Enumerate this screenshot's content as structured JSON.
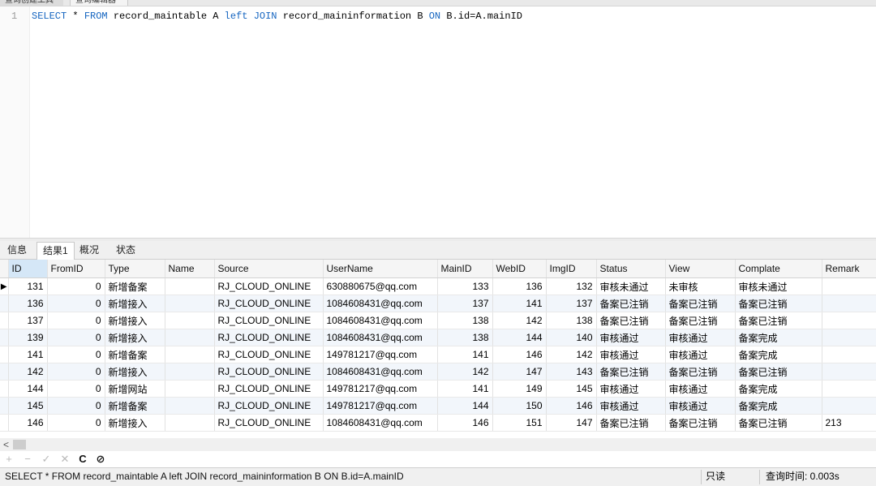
{
  "top_tabs": [
    "查询创建工具",
    "查询编辑器"
  ],
  "editor": {
    "line_number": "1",
    "sql_tokens": [
      {
        "t": "SELECT",
        "kw": true
      },
      {
        "t": " * ",
        "kw": false
      },
      {
        "t": "FROM",
        "kw": true
      },
      {
        "t": " record_maintable A ",
        "kw": false
      },
      {
        "t": "left",
        "kw": true
      },
      {
        "t": " ",
        "kw": false
      },
      {
        "t": "JOIN",
        "kw": true
      },
      {
        "t": " record_maininformation B ",
        "kw": false
      },
      {
        "t": "ON",
        "kw": true
      },
      {
        "t": " B.id=A.mainID",
        "kw": false
      }
    ]
  },
  "result_tabs": [
    {
      "label": "信息",
      "active": false
    },
    {
      "label": "结果1",
      "active": true
    },
    {
      "label": "概况",
      "active": false
    },
    {
      "label": "状态",
      "active": false
    }
  ],
  "grid": {
    "columns": [
      "ID",
      "FromID",
      "Type",
      "Name",
      "Source",
      "UserName",
      "MainID",
      "WebID",
      "ImgID",
      "Status",
      "View",
      "Complate",
      "Remark"
    ],
    "current_row_marker": "▶",
    "rows": [
      [
        "131",
        "0",
        "新增备案",
        "",
        "RJ_CLOUD_ONLINE",
        "630880675@qq.com",
        "133",
        "136",
        "132",
        "审核未通过",
        "未审核",
        "审核未通过",
        ""
      ],
      [
        "136",
        "0",
        "新增接入",
        "",
        "RJ_CLOUD_ONLINE",
        "1084608431@qq.com",
        "137",
        "141",
        "137",
        "备案已注销",
        "备案已注销",
        "备案已注销",
        ""
      ],
      [
        "137",
        "0",
        "新增接入",
        "",
        "RJ_CLOUD_ONLINE",
        "1084608431@qq.com",
        "138",
        "142",
        "138",
        "备案已注销",
        "备案已注销",
        "备案已注销",
        ""
      ],
      [
        "139",
        "0",
        "新增接入",
        "",
        "RJ_CLOUD_ONLINE",
        "1084608431@qq.com",
        "138",
        "144",
        "140",
        "审核通过",
        "审核通过",
        "备案完成",
        ""
      ],
      [
        "141",
        "0",
        "新增备案",
        "",
        "RJ_CLOUD_ONLINE",
        "149781217@qq.com",
        "141",
        "146",
        "142",
        "审核通过",
        "审核通过",
        "备案完成",
        ""
      ],
      [
        "142",
        "0",
        "新增接入",
        "",
        "RJ_CLOUD_ONLINE",
        "1084608431@qq.com",
        "142",
        "147",
        "143",
        "备案已注销",
        "备案已注销",
        "备案已注销",
        ""
      ],
      [
        "144",
        "0",
        "新增网站",
        "",
        "RJ_CLOUD_ONLINE",
        "149781217@qq.com",
        "141",
        "149",
        "145",
        "审核通过",
        "审核通过",
        "备案完成",
        ""
      ],
      [
        "145",
        "0",
        "新增备案",
        "",
        "RJ_CLOUD_ONLINE",
        "149781217@qq.com",
        "144",
        "150",
        "146",
        "审核通过",
        "审核通过",
        "备案完成",
        ""
      ],
      [
        "146",
        "0",
        "新增接入",
        "",
        "RJ_CLOUD_ONLINE",
        "1084608431@qq.com",
        "146",
        "151",
        "147",
        "备案已注销",
        "备案已注销",
        "备案已注销",
        "213"
      ]
    ]
  },
  "scrollbar": {
    "left_arrow": "<"
  },
  "toolbar": {
    "add": "+",
    "delete": "−",
    "apply": "✓",
    "cancel": "✕",
    "refresh": "C",
    "stop": "⊘",
    "icons": [
      "plus-icon",
      "minus-icon",
      "check-icon",
      "cross-icon",
      "refresh-icon",
      "stop-icon"
    ]
  },
  "status": {
    "sql": "SELECT * FROM record_maintable A left JOIN record_maininformation B ON B.id=A.mainID",
    "read_only": "只读",
    "query_time": "查询时间: 0.003s"
  }
}
